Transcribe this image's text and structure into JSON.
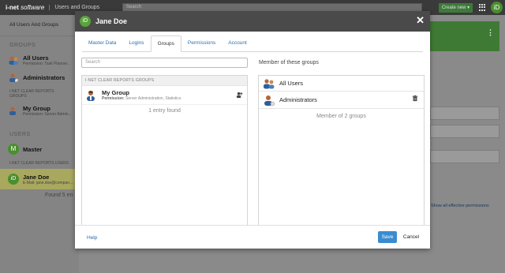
{
  "topbar": {
    "brand": "i-net",
    "brand_suffix": "software",
    "app_title": "Users and Groups",
    "search_placeholder": "Search",
    "create_label": "Create new ▾",
    "avatar_initials": "iD"
  },
  "background": {
    "header": "All Users And Groups",
    "groups_heading": "GROUPS",
    "groups": [
      {
        "name": "All Users",
        "sub": "Permission: Task Planner..."
      },
      {
        "name": "Administrators",
        "sub": ""
      }
    ],
    "clear_reports_groups_heading": "I-NET CLEAR REPORTS GROUPS",
    "clear_group": {
      "name": "My Group",
      "sub": "Permission: Server Admin..."
    },
    "users_heading": "USERS",
    "users": [
      {
        "name": "Master",
        "initial": "M"
      }
    ],
    "clear_reports_users_heading": "I-NET CLEAR REPORTS USERS",
    "selected_user": {
      "name": "Jane Doe",
      "sub": "E-Mail: jane.doe@compan...",
      "initials": "iD"
    },
    "found_text": "Found 5 en",
    "right_link": "Show all effective permissions"
  },
  "modal": {
    "avatar_initials": "iD",
    "title": "Jane Doe",
    "close_label": "✕",
    "tabs": [
      {
        "label": "Master Data",
        "active": false
      },
      {
        "label": "Logins",
        "active": false
      },
      {
        "label": "Groups",
        "active": true
      },
      {
        "label": "Permissions",
        "active": false
      },
      {
        "label": "Account",
        "active": false
      }
    ],
    "search_placeholder": "Search",
    "available_section": "I-NET CLEAR REPORTS GROUPS",
    "available_groups": [
      {
        "name": "My Group",
        "permission_label": "Permission:",
        "permission_value": "Server Administration, Statistics"
      }
    ],
    "available_count": "1 entry found",
    "member_title": "Member of these groups",
    "member_groups": [
      {
        "name": "All Users",
        "removable": false
      },
      {
        "name": "Administrators",
        "removable": true
      }
    ],
    "member_count": "Member of 2 groups",
    "help_label": "Help",
    "save_label": "Save",
    "cancel_label": "Cancel"
  },
  "colors": {
    "accent": "#3a8cd0",
    "brand_green": "#5aa33a",
    "link": "#2c6fad"
  }
}
